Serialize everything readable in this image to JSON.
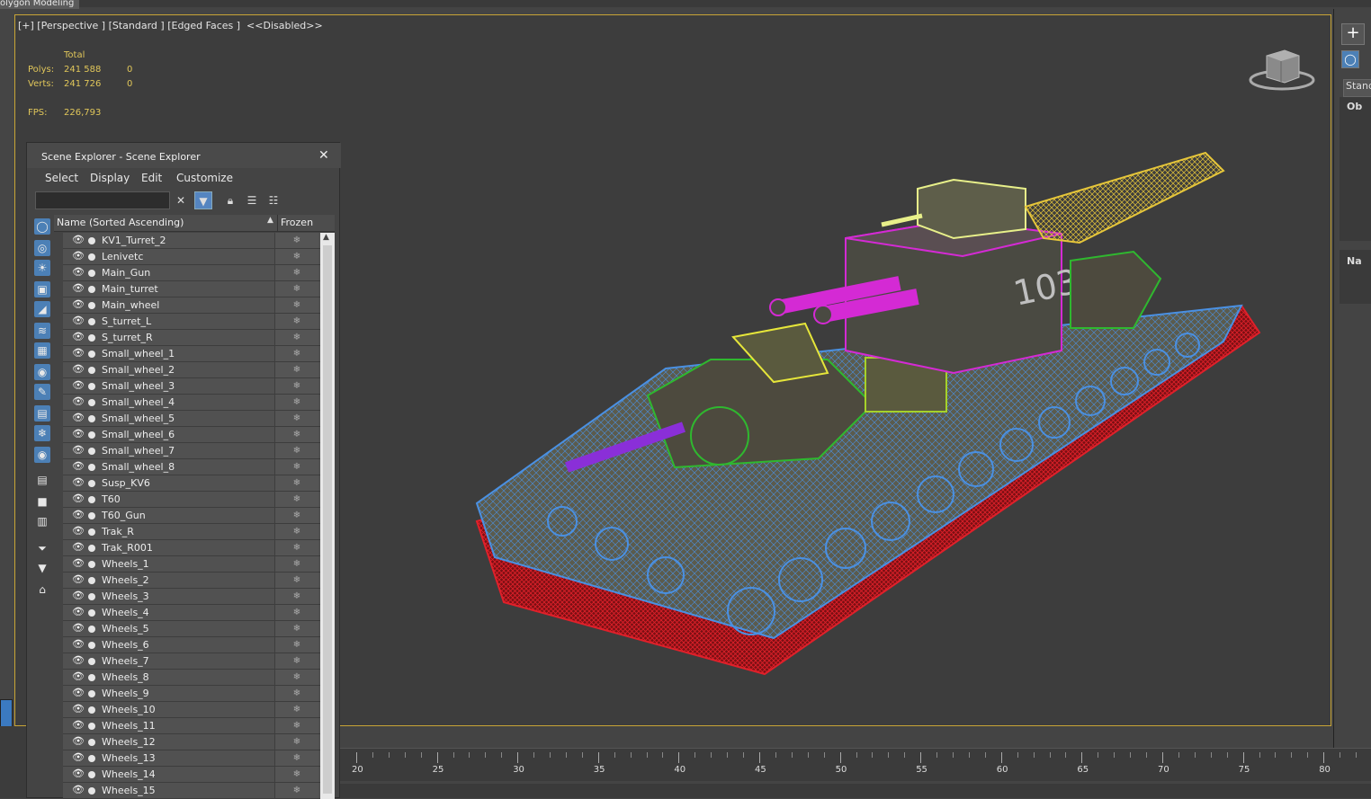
{
  "app": {
    "ribbon_tab": "olygon Modeling"
  },
  "viewport": {
    "label": "[+] [Perspective ] [Standard ] [Edged Faces ]  <<Disabled>>",
    "stats": {
      "header": "Total",
      "polys_label": "Polys:",
      "polys_total": "241 588",
      "polys_sel": "0",
      "verts_label": "Verts:",
      "verts_total": "241 726",
      "verts_sel": "0",
      "fps_label": "FPS:",
      "fps_value": "226,793"
    },
    "turret_number": "103"
  },
  "right_panel": {
    "create_glyph": "+",
    "dropdown_text": "Stand",
    "rollout1": "Ob",
    "rollout2": "Na"
  },
  "scene_explorer": {
    "title": "Scene Explorer - Scene Explorer",
    "close": "✕",
    "menu": [
      "Select",
      "Display",
      "Edit",
      "Customize"
    ],
    "search_placeholder": "",
    "col_name": "Name (Sorted Ascending)",
    "col_sort_glyph": "▲",
    "col_frozen": "Frozen",
    "items": [
      "KV1_Turret_2",
      "Lenivetc",
      "Main_Gun",
      "Main_turret",
      "Main_wheel",
      "S_turret_L",
      "S_turret_R",
      "Small_wheel_1",
      "Small_wheel_2",
      "Small_wheel_3",
      "Small_wheel_4",
      "Small_wheel_5",
      "Small_wheel_6",
      "Small_wheel_7",
      "Small_wheel_8",
      "Susp_KV6",
      "T60",
      "T60_Gun",
      "Trak_R",
      "Trak_R001",
      "Wheels_1",
      "Wheels_2",
      "Wheels_3",
      "Wheels_4",
      "Wheels_5",
      "Wheels_6",
      "Wheels_7",
      "Wheels_8",
      "Wheels_9",
      "Wheels_10",
      "Wheels_11",
      "Wheels_12",
      "Wheels_13",
      "Wheels_14",
      "Wheels_15"
    ],
    "frozen_glyph": "❄"
  },
  "timeline": {
    "labels": [
      "20",
      "25",
      "30",
      "35",
      "40",
      "45",
      "50",
      "55",
      "60",
      "65",
      "70",
      "75",
      "80"
    ]
  },
  "colors": {
    "viewport_border": "#c8a536",
    "stats_text": "#e0c65a",
    "accent_blue": "#4c80b6",
    "wire_blue": "#4a90e2",
    "wire_red": "#c0151c",
    "wire_magenta": "#d42ad4",
    "wire_green": "#2fb82f",
    "wire_yellow": "#e6d23a"
  }
}
